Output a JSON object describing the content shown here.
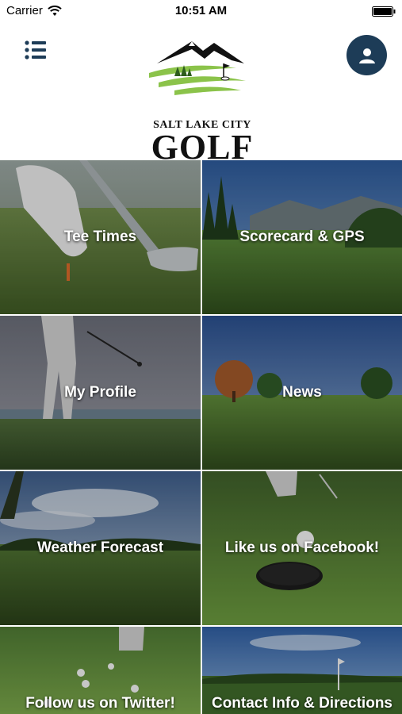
{
  "status_bar": {
    "carrier": "Carrier",
    "time": "10:51 AM"
  },
  "header": {
    "menu_icon": "list-menu-icon",
    "profile_icon": "user-icon",
    "logo": {
      "line1": "SALT LAKE CITY",
      "line2": "GOLF"
    },
    "colors": {
      "profile_button": "#1d3c57",
      "menu_icon": "#1d3c57",
      "logo_green": "#8bc34a"
    }
  },
  "tiles": [
    {
      "label": "Tee Times"
    },
    {
      "label": "Scorecard & GPS"
    },
    {
      "label": "My Profile"
    },
    {
      "label": "News"
    },
    {
      "label": "Weather Forecast"
    },
    {
      "label": "Like us on Facebook!"
    },
    {
      "label": "Follow us on Twitter!"
    },
    {
      "label": "Contact Info & Directions"
    }
  ]
}
